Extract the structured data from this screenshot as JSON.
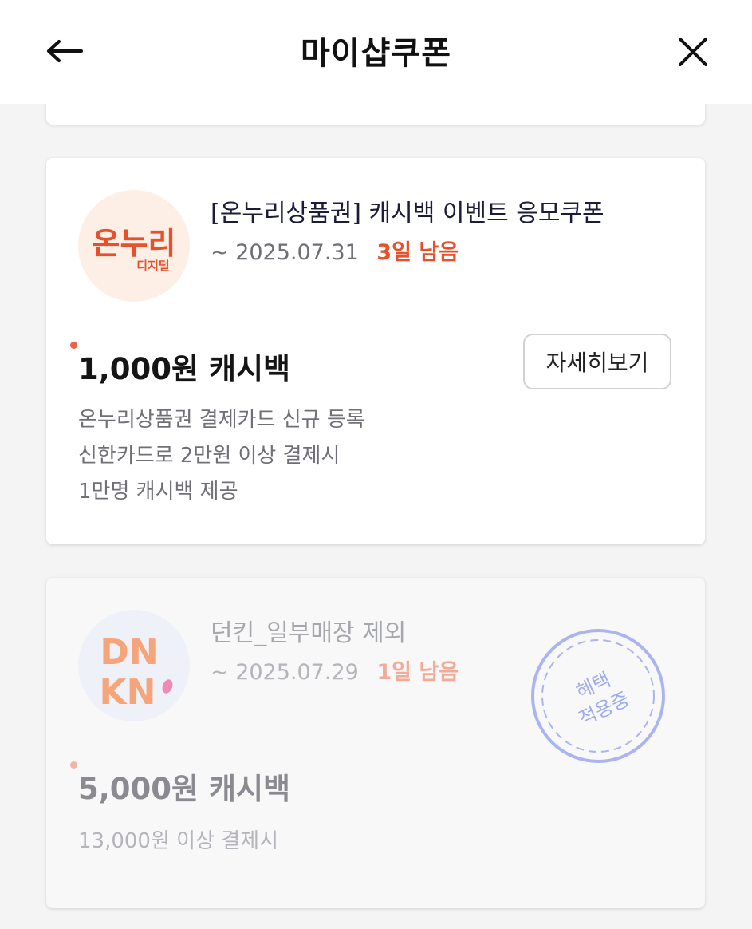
{
  "header": {
    "title": "마이샵쿠폰",
    "back_icon": "arrow-left-icon",
    "close_icon": "close-icon"
  },
  "coupons": [
    {
      "logo_text": "온누리",
      "logo_subtext": "디지털",
      "title": "[온누리상품권] 캐시백 이벤트 응모쿠폰",
      "date": "~ 2025.07.31",
      "remaining": "3일 남음",
      "amount": "1,000원 캐시백",
      "detail_button": "자세히보기",
      "desc": [
        "온누리상품권 결제카드 신규 등록",
        "신한카드로 2만원 이상 결제시",
        "1만명 캐시백 제공"
      ]
    },
    {
      "logo_text_top": "DN",
      "logo_text_bottom": "KN",
      "title": "던킨_일부매장 제외",
      "date": "~ 2025.07.29",
      "remaining": "1일 남음",
      "amount": "5,000원 캐시백",
      "stamp_line1": "혜택",
      "stamp_line2": "적용중",
      "desc": [
        "13,000원 이상 결제시"
      ]
    }
  ],
  "colors": {
    "accent": "#e8502c",
    "accent_dim": "#f3aa96",
    "stamp": "#aab5f0",
    "background": "#f4f4f5"
  }
}
